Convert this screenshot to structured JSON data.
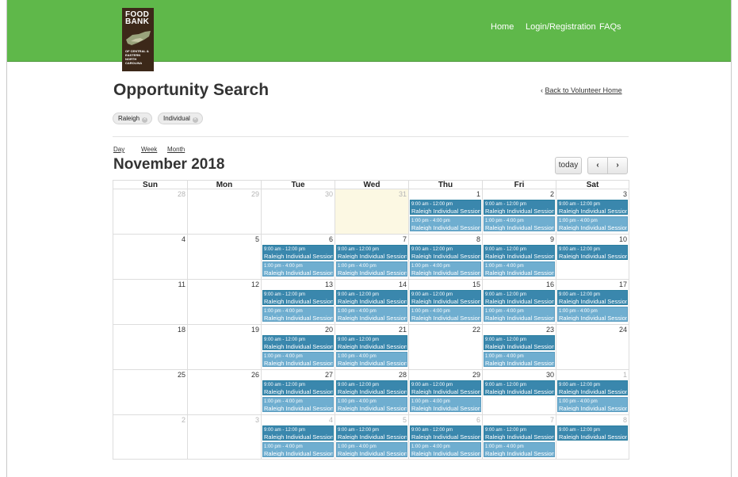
{
  "header": {
    "logo_line1": "FOOD",
    "logo_line2": "BANK",
    "logo_small": "OF CENTRAL & EASTERN NORTH CAROLINA",
    "nav": [
      "Home",
      "Login/Registration",
      "FAQs"
    ]
  },
  "page": {
    "title": "Opportunity Search",
    "back_arrow": "‹",
    "back_link": "Back to Volunteer Home"
  },
  "filters": [
    "Raleigh",
    "Individual"
  ],
  "views": [
    "Day",
    "Week",
    "Month"
  ],
  "calendar": {
    "month_title": "November 2018",
    "today_label": "today",
    "prev_icon": "‹",
    "next_icon": "›",
    "weekdays": [
      "Sun",
      "Mon",
      "Tue",
      "Wed",
      "Thu",
      "Fri",
      "Sat"
    ],
    "weeks": [
      [
        {
          "day": "28",
          "other": true,
          "events": []
        },
        {
          "day": "29",
          "other": true,
          "events": []
        },
        {
          "day": "30",
          "other": true,
          "events": []
        },
        {
          "day": "31",
          "other": true,
          "today": true,
          "events": []
        },
        {
          "day": "1",
          "events": [
            {
              "time": "9:00 am - 12:00 pm",
              "name": "Raleigh Individual Session"
            },
            {
              "time": "1:00 pm - 4:00 pm",
              "name": "Raleigh Individual Session"
            }
          ]
        },
        {
          "day": "2",
          "events": [
            {
              "time": "9:00 am - 12:00 pm",
              "name": "Raleigh Individual Session"
            },
            {
              "time": "1:00 pm - 4:00 pm",
              "name": "Raleigh Individual Session"
            }
          ]
        },
        {
          "day": "3",
          "events": [
            {
              "time": "9:00 am - 12:00 pm",
              "name": "Raleigh Individual Session"
            },
            {
              "time": "1:00 pm - 4:00 pm",
              "name": "Raleigh Individual Session"
            }
          ]
        }
      ],
      [
        {
          "day": "4",
          "events": []
        },
        {
          "day": "5",
          "events": []
        },
        {
          "day": "6",
          "events": [
            {
              "time": "9:00 am - 12:00 pm",
              "name": "Raleigh Individual Session"
            },
            {
              "time": "1:00 pm - 4:00 pm",
              "name": "Raleigh Individual Session"
            }
          ]
        },
        {
          "day": "7",
          "events": [
            {
              "time": "9:00 am - 12:00 pm",
              "name": "Raleigh Individual Session"
            },
            {
              "time": "1:00 pm - 4:00 pm",
              "name": "Raleigh Individual Session"
            }
          ]
        },
        {
          "day": "8",
          "events": [
            {
              "time": "9:00 am - 12:00 pm",
              "name": "Raleigh Individual Session"
            },
            {
              "time": "1:00 pm - 4:00 pm",
              "name": "Raleigh Individual Session"
            }
          ]
        },
        {
          "day": "9",
          "events": [
            {
              "time": "9:00 am - 12:00 pm",
              "name": "Raleigh Individual Session"
            },
            {
              "time": "1:00 pm - 4:00 pm",
              "name": "Raleigh Individual Session"
            }
          ]
        },
        {
          "day": "10",
          "events": [
            {
              "time": "9:00 am - 12:00 pm",
              "name": "Raleigh Individual Session"
            }
          ]
        }
      ],
      [
        {
          "day": "11",
          "events": []
        },
        {
          "day": "12",
          "events": []
        },
        {
          "day": "13",
          "events": [
            {
              "time": "9:00 am - 12:00 pm",
              "name": "Raleigh Individual Session"
            },
            {
              "time": "1:00 pm - 4:00 pm",
              "name": "Raleigh Individual Session"
            }
          ]
        },
        {
          "day": "14",
          "events": [
            {
              "time": "9:00 am - 12:00 pm",
              "name": "Raleigh Individual Session"
            },
            {
              "time": "1:00 pm - 4:00 pm",
              "name": "Raleigh Individual Session"
            }
          ]
        },
        {
          "day": "15",
          "events": [
            {
              "time": "9:00 am - 12:00 pm",
              "name": "Raleigh Individual Session"
            },
            {
              "time": "1:00 pm - 4:00 pm",
              "name": "Raleigh Individual Session"
            }
          ]
        },
        {
          "day": "16",
          "events": [
            {
              "time": "9:00 am - 12:00 pm",
              "name": "Raleigh Individual Session"
            },
            {
              "time": "1:00 pm - 4:00 pm",
              "name": "Raleigh Individual Session"
            }
          ]
        },
        {
          "day": "17",
          "events": [
            {
              "time": "9:00 am - 12:00 pm",
              "name": "Raleigh Individual Session"
            },
            {
              "time": "1:00 pm - 4:00 pm",
              "name": "Raleigh Individual Session"
            }
          ]
        }
      ],
      [
        {
          "day": "18",
          "events": []
        },
        {
          "day": "19",
          "events": []
        },
        {
          "day": "20",
          "events": [
            {
              "time": "9:00 am - 12:00 pm",
              "name": "Raleigh Individual Session"
            },
            {
              "time": "1:00 pm - 4:00 pm",
              "name": "Raleigh Individual Session"
            }
          ]
        },
        {
          "day": "21",
          "events": [
            {
              "time": "9:00 am - 12:00 pm",
              "name": "Raleigh Individual Session"
            },
            {
              "time": "1:00 pm - 4:00 pm",
              "name": "Raleigh Individual Session"
            }
          ]
        },
        {
          "day": "22",
          "events": []
        },
        {
          "day": "23",
          "events": [
            {
              "time": "9:00 am - 12:00 pm",
              "name": "Raleigh Individual Session"
            },
            {
              "time": "1:00 pm - 4:00 pm",
              "name": "Raleigh Individual Session"
            }
          ]
        },
        {
          "day": "24",
          "events": []
        }
      ],
      [
        {
          "day": "25",
          "events": []
        },
        {
          "day": "26",
          "events": []
        },
        {
          "day": "27",
          "events": [
            {
              "time": "9:00 am - 12:00 pm",
              "name": "Raleigh Individual Session"
            },
            {
              "time": "1:00 pm - 4:00 pm",
              "name": "Raleigh Individual Session"
            }
          ]
        },
        {
          "day": "28",
          "events": [
            {
              "time": "9:00 am - 12:00 pm",
              "name": "Raleigh Individual Session"
            },
            {
              "time": "1:00 pm - 4:00 pm",
              "name": "Raleigh Individual Session"
            }
          ]
        },
        {
          "day": "29",
          "events": [
            {
              "time": "9:00 am - 12:00 pm",
              "name": "Raleigh Individual Session"
            },
            {
              "time": "1:00 pm - 4:00 pm",
              "name": "Raleigh Individual Session"
            }
          ]
        },
        {
          "day": "30",
          "events": [
            {
              "time": "9:00 am - 12:00 pm",
              "name": "Raleigh Individual Session"
            }
          ]
        },
        {
          "day": "1",
          "other": true,
          "events": [
            {
              "time": "9:00 am - 12:00 pm",
              "name": "Raleigh Individual Session"
            },
            {
              "time": "1:00 pm - 4:00 pm",
              "name": "Raleigh Individual Session"
            }
          ]
        }
      ],
      [
        {
          "day": "2",
          "other": true,
          "events": []
        },
        {
          "day": "3",
          "other": true,
          "events": []
        },
        {
          "day": "4",
          "other": true,
          "events": [
            {
              "time": "9:00 am - 12:00 pm",
              "name": "Raleigh Individual Session"
            },
            {
              "time": "1:00 pm - 4:00 pm",
              "name": "Raleigh Individual Session"
            }
          ]
        },
        {
          "day": "5",
          "other": true,
          "events": [
            {
              "time": "9:00 am - 12:00 pm",
              "name": "Raleigh Individual Session"
            },
            {
              "time": "1:00 pm - 4:00 pm",
              "name": "Raleigh Individual Session"
            }
          ]
        },
        {
          "day": "6",
          "other": true,
          "events": [
            {
              "time": "9:00 am - 12:00 pm",
              "name": "Raleigh Individual Session"
            },
            {
              "time": "1:00 pm - 4:00 pm",
              "name": "Raleigh Individual Session"
            }
          ]
        },
        {
          "day": "7",
          "other": true,
          "events": [
            {
              "time": "9:00 am - 12:00 pm",
              "name": "Raleigh Individual Session"
            },
            {
              "time": "1:00 pm - 4:00 pm",
              "name": "Raleigh Individual Session"
            }
          ]
        },
        {
          "day": "8",
          "other": true,
          "events": [
            {
              "time": "9:00 am - 12:00 pm",
              "name": "Raleigh Individual Session"
            }
          ]
        }
      ]
    ]
  },
  "colors": {
    "header_green": "#5fb84a",
    "logo_brown": "#3c2819",
    "event_dark": "#3a87ad",
    "event_light": "#6faed0",
    "today_bg": "#fcf8e3"
  }
}
